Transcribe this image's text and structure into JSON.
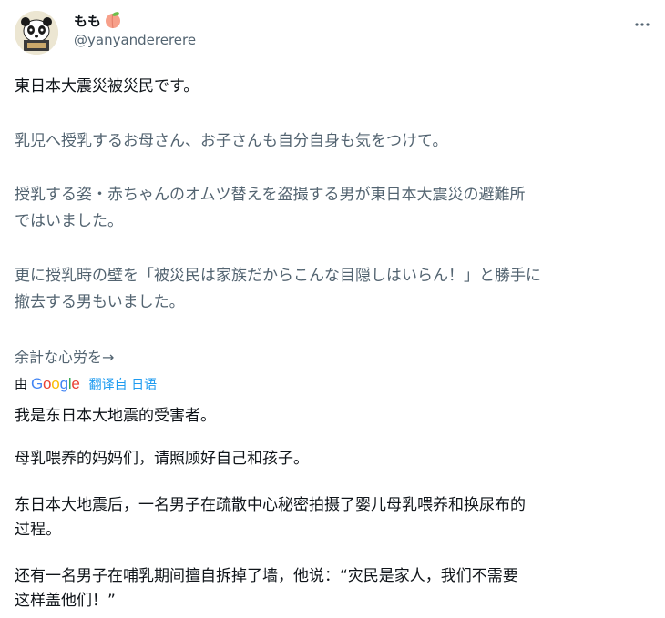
{
  "author": {
    "display_name": "もも",
    "handle": "@yanyandererere",
    "avatar_icon": "panda-avatar-icon",
    "name_emoji": "peach-icon"
  },
  "menu_icon": "more-dots-icon",
  "original_text": {
    "line1": "東日本大震災被災民です。",
    "line2": "乳児へ授乳するお母さん、お子さんも自分自身も気をつけて。",
    "line3a": "授乳する姿・赤ちゃんのオムツ替えを盗撮する男が東日本大震災の避難所",
    "line3b": "ではいました。",
    "line4a": "更に授乳時の壁を「被災民は家族だからこんな目隠しはいらん！」と勝手に",
    "line4b": "撤去する男もいました。",
    "line5": "余計な心労を→"
  },
  "translation_bar": {
    "by_label": "由",
    "provider": "Google",
    "link_label": "翻译自 日语"
  },
  "translated_text": {
    "line1": "我是东日本大地震的受害者。",
    "line2": "母乳喂养的妈妈们，请照顾好自己和孩子。",
    "line3a": "东日本大地震后，一名男子在疏散中心秘密拍摄了婴儿母乳喂养和换尿布的",
    "line3b": "过程。",
    "line4a": "还有一名男子在哺乳期间擅自拆掉了墙，他说：“灾民是家人，我们不需要",
    "line4b": "这样盖他们！”"
  }
}
